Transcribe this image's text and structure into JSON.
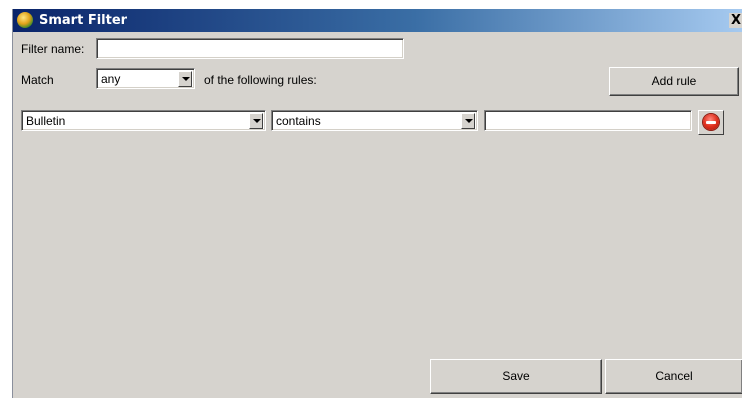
{
  "window": {
    "title": "Smart Filter",
    "close_glyph": "X",
    "app_icon": "smart-filter-app-icon"
  },
  "filter": {
    "name_label": "Filter name:",
    "name_value": "",
    "match_label": "Match",
    "match_value": "any",
    "match_suffix": "of the following rules:",
    "add_rule_label": "Add rule"
  },
  "rules": [
    {
      "field": "Bulletin",
      "operator": "contains",
      "value": "",
      "remove_icon": "remove-icon"
    }
  ],
  "footer": {
    "save_label": "Save",
    "cancel_label": "Cancel"
  },
  "colors": {
    "dialog_background": "#d6d3ce",
    "titlebar_start": "#0a246a",
    "titlebar_end": "#a6caf0",
    "remove_icon": "#e0301e"
  }
}
